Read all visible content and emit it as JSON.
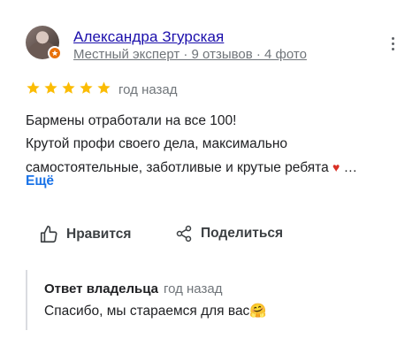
{
  "review": {
    "author_name": "Александра Згурская",
    "author_meta": "Местный эксперт · 9 отзывов · 4 фото",
    "rating": 5,
    "rating_max": 5,
    "time": "год назад",
    "text_lines": [
      "Бармены отработали на все 100!",
      "Крутой профи своего дела, максимально",
      "самостоятельные, заботливые и крутые ребята"
    ],
    "heart": "♥",
    "ellipsis": " …",
    "more_label": "Ещё"
  },
  "actions": {
    "like_label": "Нравится",
    "share_label": "Поделиться"
  },
  "owner_reply": {
    "label": "Ответ владельца",
    "time": "год назад",
    "text": "Спасибо, мы стараемся для вас🤗"
  },
  "colors": {
    "star": "#fbbc04",
    "link": "#1a73e8",
    "badge": "#e8710a",
    "heart": "#d93025"
  },
  "icons": {
    "avatar_badge": "local-guide-star-icon",
    "menu": "more-vert-icon",
    "like": "thumb-up-icon",
    "share": "share-icon"
  }
}
